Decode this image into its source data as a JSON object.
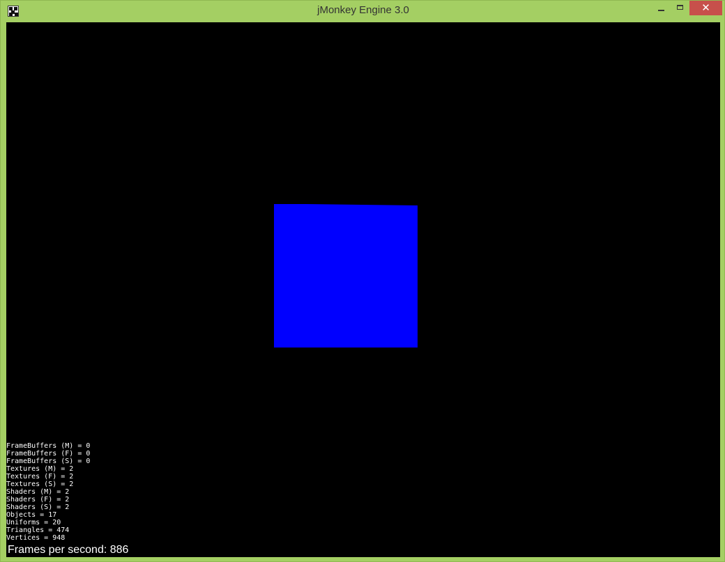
{
  "window": {
    "title": "jMonkey Engine 3.0",
    "app_icon": "jmonkey-app-icon",
    "controls": {
      "minimize_icon": "minimize-icon",
      "maximize_icon": "maximize-icon",
      "close_icon": "close-icon",
      "close_glyph": "✕"
    },
    "colors": {
      "frame": "#a4cf63",
      "close_button": "#c7504b",
      "viewport_background": "#000000",
      "cube": "#0000ff",
      "hud_text": "#ffffff"
    }
  },
  "stats": [
    "FrameBuffers (M) = 0",
    "FrameBuffers (F) = 0",
    "FrameBuffers (S) = 0",
    "Textures (M) = 2",
    "Textures (F) = 2",
    "Textures (S) = 2",
    "Shaders (M) = 2",
    "Shaders (F) = 2",
    "Shaders (S) = 2",
    "Objects = 17",
    "Uniforms = 20",
    "Triangles = 474",
    "Vertices = 948"
  ],
  "fps_text": "Frames per second: 886"
}
